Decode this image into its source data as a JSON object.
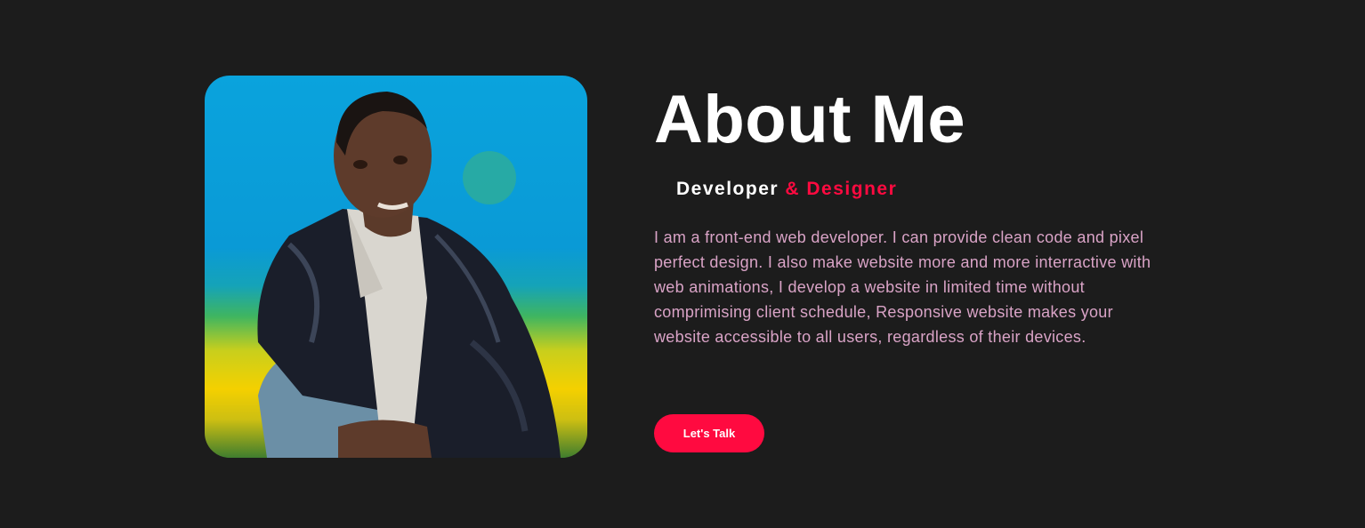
{
  "colors": {
    "background": "#1c1c1c",
    "accent": "#ff0a40",
    "body_text": "#d9a3c6",
    "heading": "#ffffff"
  },
  "about": {
    "photo_alt": "portrait photo",
    "title": "About Me",
    "role_primary": "Developer",
    "role_accent": "& Designer",
    "description": "I am a front-end web developer. I can provide clean code and pixel perfect design. I also make website more and more interractive with web animations, I develop a website in limited time without comprimising client schedule, Responsive website makes your website accessible to all users, regardless of their devices.",
    "cta_label": "Let's Talk"
  }
}
